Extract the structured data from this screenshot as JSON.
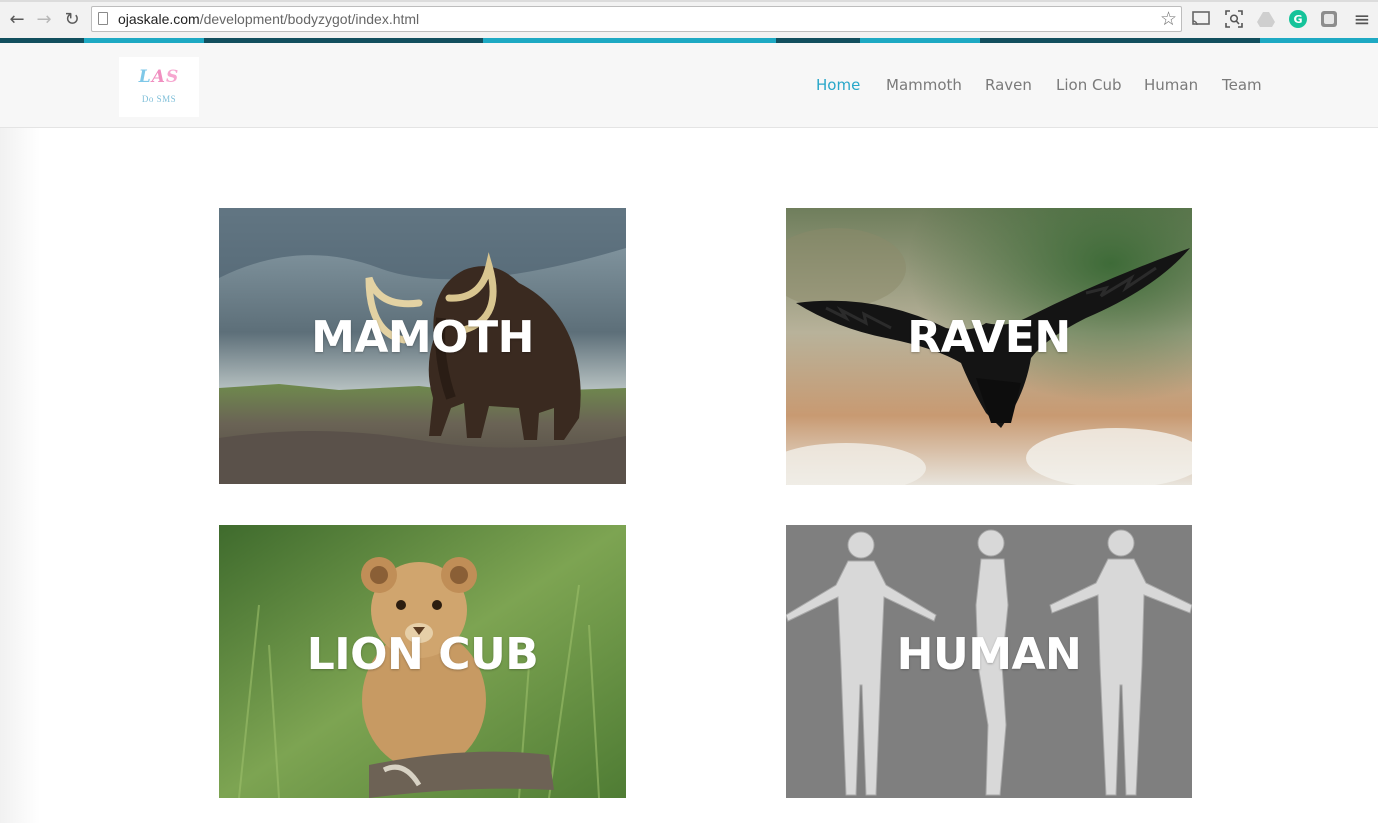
{
  "browser": {
    "url_host": "ojaskale.com",
    "url_path": "/development/bodyzygot/index.html",
    "back_icon": "←",
    "forward_icon": "→",
    "reload_icon": "↻",
    "star_icon": "☆",
    "menu_icon": "≡"
  },
  "logo": {
    "mark_1": "L",
    "mark_2": "A",
    "mark_3": "S",
    "sub": "Do SMS"
  },
  "nav": {
    "items": [
      {
        "label": "Home",
        "active": true
      },
      {
        "label": "Mammoth"
      },
      {
        "label": "Raven"
      },
      {
        "label": "Lion Cub"
      },
      {
        "label": "Human"
      },
      {
        "label": "Team"
      }
    ]
  },
  "cards": [
    {
      "title": "MAMOTH"
    },
    {
      "title": "RAVEN"
    },
    {
      "title": "LION CUB"
    },
    {
      "title": "HUMAN"
    }
  ],
  "colors": {
    "accent": "#29a7c9",
    "stripe_dark": "#124f5e",
    "stripe_light": "#1ea9c3"
  }
}
